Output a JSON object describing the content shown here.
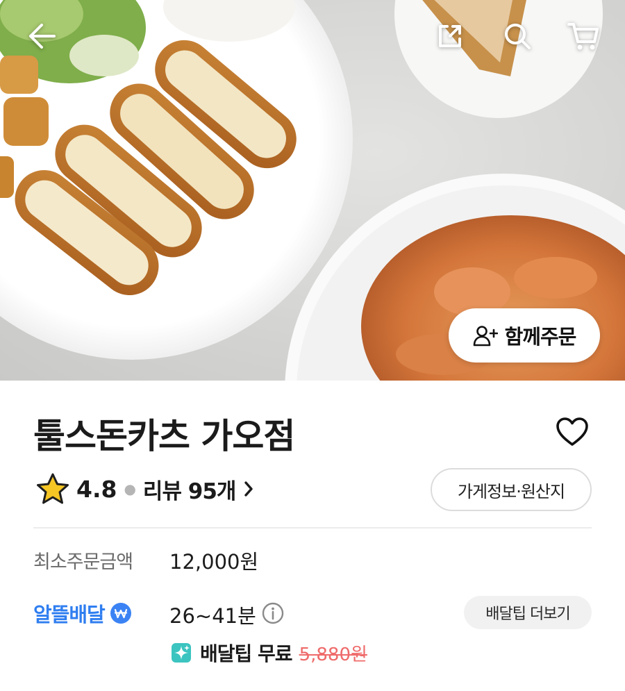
{
  "header": {
    "back_icon": "arrow-left-icon",
    "share_icon": "share-icon",
    "search_icon": "search-icon",
    "cart_icon": "cart-icon"
  },
  "hero": {
    "group_order_label": "함께주문",
    "group_order_icon": "person-add-icon"
  },
  "store": {
    "name": "툴스돈카츠 가오점",
    "favorite_icon": "heart-outline-icon",
    "rating": "4.8",
    "rating_icon": "star-icon",
    "review_label": "리뷰 95개",
    "info_button_label": "가게정보·원산지"
  },
  "delivery": {
    "min_order_label": "최소주문금액",
    "min_order_value": "12,000원",
    "type_label": "알뜰배달",
    "time_value": "26~41분",
    "tip_more_label": "배달팁 더보기",
    "free_tip_label": "배달팁 무료",
    "original_tip": "5,880원"
  },
  "colors": {
    "accent_blue": "#2f7ef0",
    "strike_red": "#ef6a6a",
    "free_icon_teal": "#3cc4c0",
    "star_yellow": "#f6c624"
  }
}
